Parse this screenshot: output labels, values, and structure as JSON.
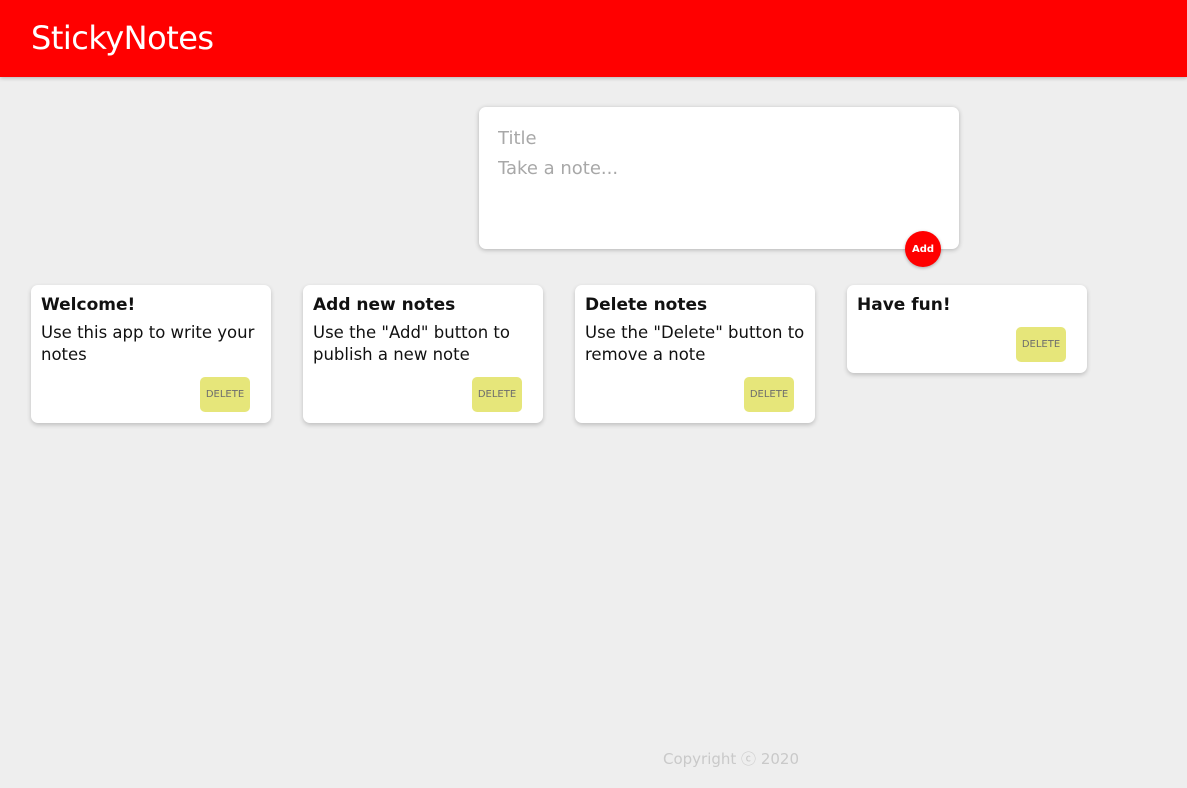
{
  "header": {
    "title": "StickyNotes",
    "color": "#ff0000"
  },
  "compose": {
    "title_placeholder": "Title",
    "content_placeholder": "Take a note...",
    "add_label": "Add"
  },
  "notes": [
    {
      "title": "Welcome!",
      "content": "Use this app to write your notes",
      "delete_label": "DELETE"
    },
    {
      "title": "Add new notes",
      "content": "Use the \"Add\" button to publish a new note",
      "delete_label": "DELETE"
    },
    {
      "title": "Delete notes",
      "content": "Use the \"Delete\" button to remove a note",
      "delete_label": "DELETE"
    },
    {
      "title": "Have fun!",
      "content": "",
      "delete_label": "DELETE"
    }
  ],
  "footer": {
    "copyright": "Copyright ⓒ 2020"
  },
  "colors": {
    "accent": "#ff0000",
    "delete_button": "#e6e67a",
    "background": "#eeeeee"
  }
}
